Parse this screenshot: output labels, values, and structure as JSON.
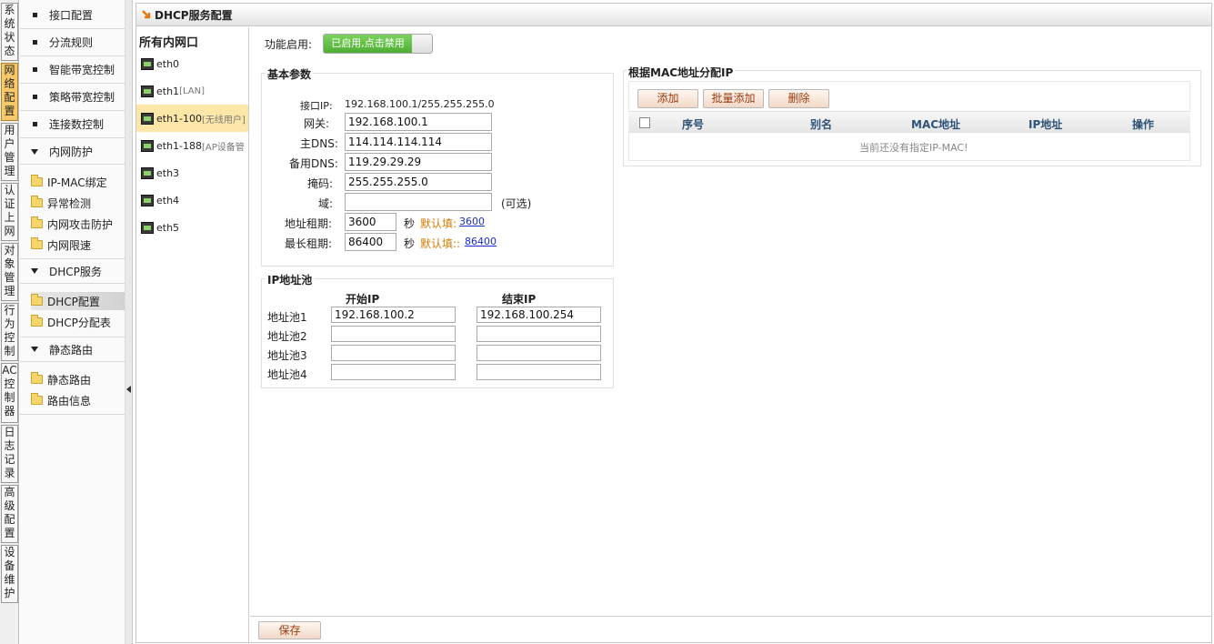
{
  "vertical_tabs": [
    {
      "label": "系统状态",
      "active": false
    },
    {
      "label": "网络配置",
      "active": true
    },
    {
      "label": "用户管理",
      "active": false
    },
    {
      "label": "认证上网",
      "active": false
    },
    {
      "label": "对象管理",
      "active": false
    },
    {
      "label": "行为控制",
      "active": false
    },
    {
      "label": "AC控制器",
      "active": false
    },
    {
      "label": "日志记录",
      "active": false
    },
    {
      "label": "高级配置",
      "active": false
    },
    {
      "label": "设备维护",
      "active": false
    }
  ],
  "sidebar": {
    "items": [
      "接口配置",
      "分流规则",
      "智能带宽控制",
      "策略带宽控制",
      "连接数控制"
    ],
    "groups": [
      {
        "label": "内网防护",
        "children": [
          "IP-MAC绑定",
          "异常检测",
          "内网攻击防护",
          "内网限速"
        ]
      },
      {
        "label": "DHCP服务",
        "children": [
          "DHCP配置",
          "DHCP分配表"
        ]
      },
      {
        "label": "静态路由",
        "children": [
          "静态路由",
          "路由信息"
        ]
      }
    ],
    "active_child": "DHCP配置"
  },
  "title": "DHCP服务配置",
  "interfaces": {
    "header": "所有内网口",
    "items": [
      {
        "name": "eth0",
        "suffix": ""
      },
      {
        "name": "eth1",
        "suffix": "[LAN]"
      },
      {
        "name": "eth1-100",
        "suffix": "[无线用户]"
      },
      {
        "name": "eth1-188",
        "suffix": "[AP设备管"
      },
      {
        "name": "eth3",
        "suffix": ""
      },
      {
        "name": "eth4",
        "suffix": ""
      },
      {
        "name": "eth5",
        "suffix": ""
      }
    ],
    "active": "eth1-100"
  },
  "function": {
    "label": "功能启用:",
    "toggle_text": "已启用,点击禁用"
  },
  "basic": {
    "legend": "基本参数",
    "iface_ip_label": "接口IP:",
    "iface_ip_value": "192.168.100.1/255.255.255.0",
    "gateway_label": "网关:",
    "gateway": "192.168.100.1",
    "dns1_label": "主DNS:",
    "dns1": "114.114.114.114",
    "dns2_label": "备用DNS:",
    "dns2": "119.29.29.29",
    "mask_label": "掩码:",
    "mask": "255.255.255.0",
    "domain_label": "域:",
    "domain": "",
    "domain_hint": "(可选)",
    "lease_label": "地址租期:",
    "lease": "3600",
    "lease_unit": "秒",
    "lease_default_label": "默认填:",
    "lease_default": "3600",
    "max_lease_label": "最长租期:",
    "max_lease": "86400",
    "max_lease_unit": "秒",
    "max_lease_default_label": "默认填::",
    "max_lease_default": "86400"
  },
  "pool": {
    "legend": "IP地址池",
    "start_header": "开始IP",
    "end_header": "结束IP",
    "rows": [
      {
        "label": "地址池1",
        "start": "192.168.100.2",
        "end": "192.168.100.254"
      },
      {
        "label": "地址池2",
        "start": "",
        "end": ""
      },
      {
        "label": "地址池3",
        "start": "",
        "end": ""
      },
      {
        "label": "地址池4",
        "start": "",
        "end": ""
      }
    ]
  },
  "mac": {
    "legend": "根据MAC地址分配IP",
    "buttons": {
      "add": "添加",
      "batch_add": "批量添加",
      "delete": "删除"
    },
    "columns": [
      "序号",
      "别名",
      "MAC地址",
      "IP地址",
      "操作"
    ],
    "empty_text": "当前还没有指定IP-MAC!"
  },
  "footer": {
    "save": "保存"
  },
  "colors": {
    "active_tab": "#f7c96b",
    "toggle_on": "#5bbd3d",
    "button_text": "#9c3a0c",
    "header_text": "#2e5376",
    "hint_orange": "#d67c00"
  }
}
